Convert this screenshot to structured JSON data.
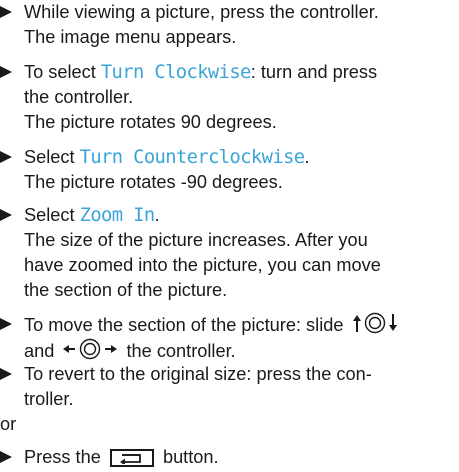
{
  "steps": [
    {
      "lines": [
        "While viewing a picture, press the controller.",
        "The image menu appears."
      ]
    },
    {
      "pre": "To select ",
      "menu": "Turn Clockwise",
      "post": ": turn and press",
      "l2": "the controller.",
      "l3": "The picture rotates 90 degrees."
    },
    {
      "pre": "Select ",
      "menu": "Turn Counterclockwise",
      "post": ".",
      "l2": "The picture rotates -90 degrees."
    },
    {
      "pre": "Select ",
      "menu": "Zoom In",
      "post": ".",
      "l2": "The size of the picture increases. After you",
      "l3": "have zoomed into the picture, you can move",
      "l4": "the section of the picture."
    },
    {
      "l1": "To move the section of the picture: slide",
      "l2a": "and",
      "l2b": "the controller."
    },
    {
      "l1": "To revert to the original size: press the con-",
      "l2": "troller."
    }
  ],
  "or_text": "or",
  "final": {
    "pre": "Press the",
    "post": "button."
  },
  "icons": {
    "bullet": "triangle-bullet-icon",
    "controller_vertical": "controller-slide-up-down-icon",
    "controller_horizontal": "controller-slide-left-right-icon",
    "back_button": "back-button-icon"
  }
}
